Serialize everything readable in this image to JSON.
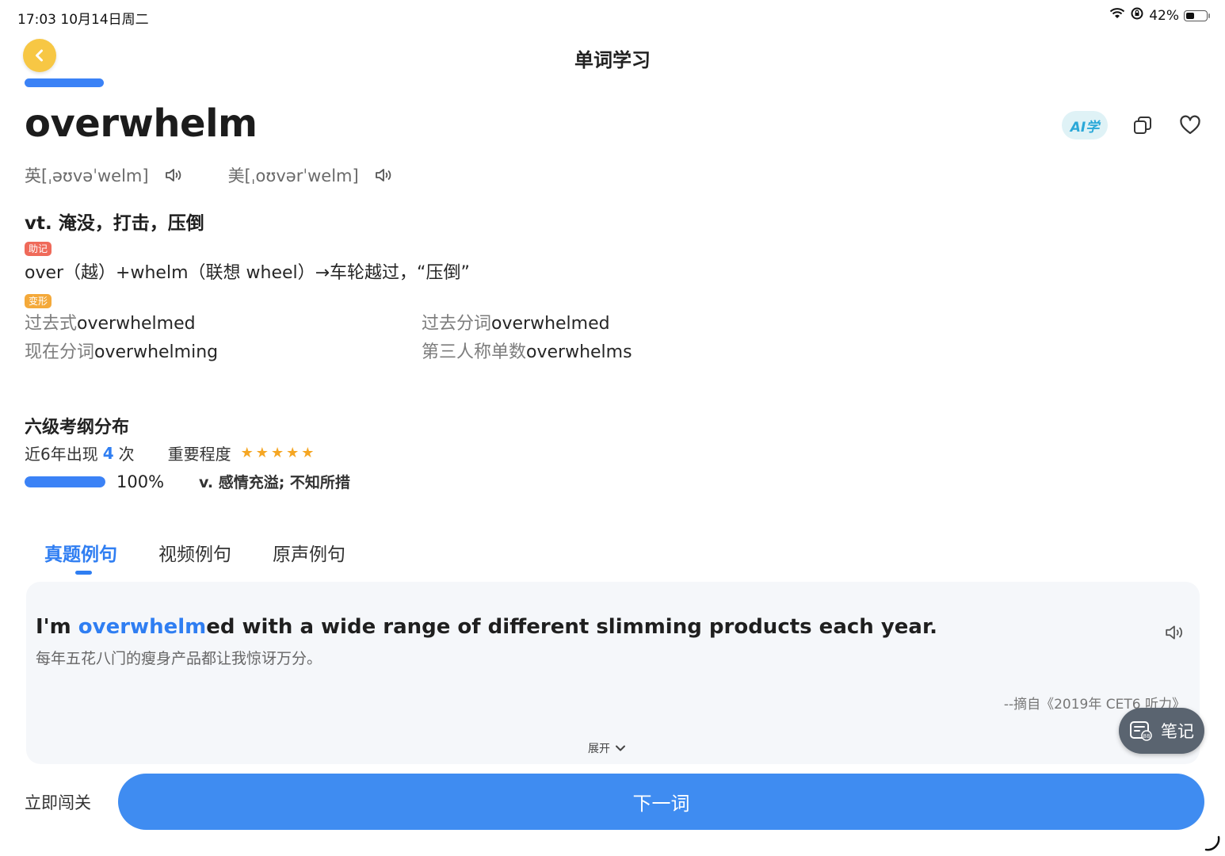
{
  "status_bar": {
    "time_date": "17:03   10月14日周二",
    "battery": "42%",
    "battery_level": 0.42
  },
  "header": {
    "title": "单词学习"
  },
  "word": {
    "text": "overwhelm",
    "ai_label": "AI学",
    "pron_uk": "英[ˌəʊvəˈwelm]",
    "pron_us": "美[ˌoʊvərˈwelm]",
    "definition": "vt. 淹没，打击，压倒"
  },
  "mnemonic": {
    "tag": "助记",
    "text": "over（越）+whelm（联想 wheel）→车轮越过，“压倒”"
  },
  "forms": {
    "tag": "变形",
    "items": [
      {
        "label": "过去式",
        "value": "overwhelmed"
      },
      {
        "label": "过去分词",
        "value": "overwhelmed"
      },
      {
        "label": "现在分词",
        "value": "overwhelming"
      },
      {
        "label": "第三人称单数",
        "value": "overwhelms"
      }
    ]
  },
  "exam": {
    "title": "六级考纲分布",
    "count_prefix": "近6年出现",
    "count": "4",
    "count_suffix": "次",
    "importance_label": "重要程度",
    "importance_stars": 5,
    "percent": "100%",
    "progress": 1.0,
    "meaning": "v. 感情充溢; 不知所措"
  },
  "tabs": {
    "items": [
      "真题例句",
      "视频例句",
      "原声例句"
    ],
    "active": 0
  },
  "example": {
    "before": "I'm ",
    "highlight": "overwhelm",
    "after": "ed with a wide range of different slimming products each year.",
    "translation": "每年五花八门的瘦身产品都让我惊讶万分。",
    "source": "--摘自《2019年 CET6 听力》",
    "expand_label": "展开"
  },
  "note_button": {
    "label": "笔记"
  },
  "actions": {
    "pass_label": "立即闯关",
    "next_label": "下一词"
  },
  "colors": {
    "accent": "#3b82f6",
    "back_button": "#f7c744",
    "star": "#f5a623"
  }
}
